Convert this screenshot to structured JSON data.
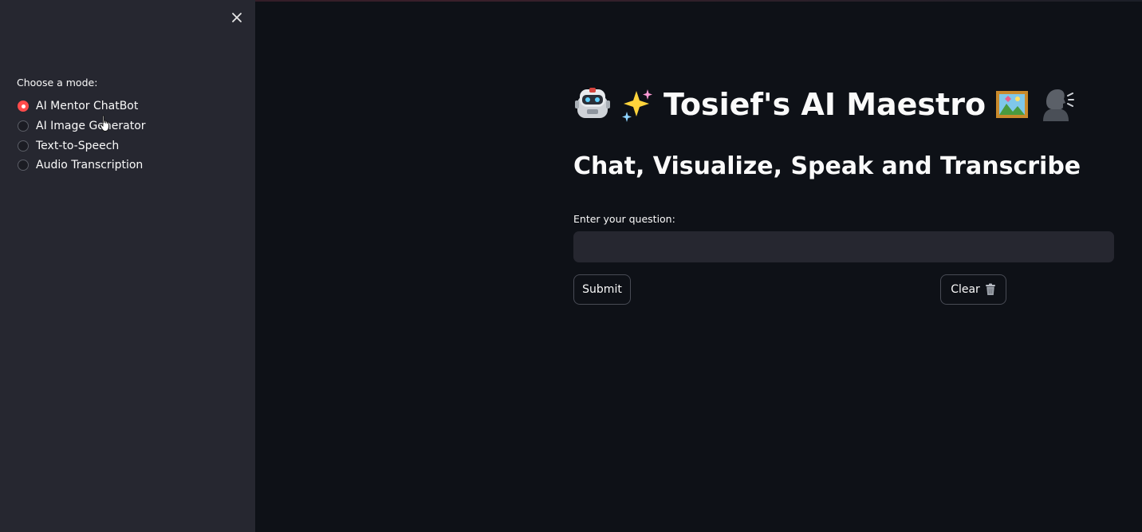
{
  "sidebar": {
    "close_icon": "close-icon",
    "mode_label": "Choose a mode:",
    "modes": [
      {
        "label": "AI Mentor ChatBot",
        "selected": true
      },
      {
        "label": "AI Image Generator",
        "selected": false
      },
      {
        "label": "Text-to-Speech",
        "selected": false
      },
      {
        "label": "Audio Transcription",
        "selected": false
      }
    ]
  },
  "main": {
    "title": "Tosief's AI Maestro",
    "title_icons_left": [
      "robot-icon",
      "sparkles-icon"
    ],
    "title_icons_right": [
      "framed-picture-icon",
      "speaking-head-icon"
    ],
    "subtitle": "Chat, Visualize, Speak and Transcribe",
    "question_label": "Enter your question:",
    "question_value": "",
    "submit_label": "Submit",
    "clear_label": "Clear",
    "clear_icon": "wastebasket-icon"
  },
  "colors": {
    "background": "#0e1117",
    "sidebar": "#262730",
    "accent": "#ff4b4b",
    "input_bg": "#262730"
  }
}
